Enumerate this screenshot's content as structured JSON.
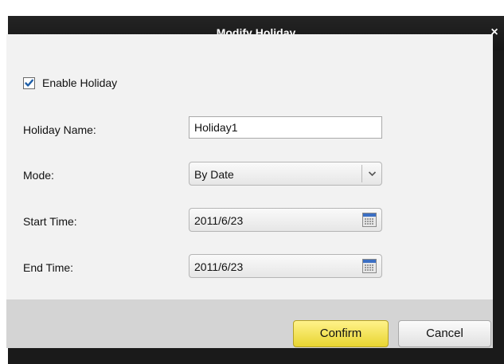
{
  "dialog": {
    "title": "Modify Holiday",
    "close_icon": "close-icon",
    "close_glyph": "×"
  },
  "form": {
    "enable": {
      "label": "Enable Holiday",
      "checked": true
    },
    "holiday_name": {
      "label": "Holiday Name:",
      "value": "Holiday1"
    },
    "mode": {
      "label": "Mode:",
      "value": "By Date",
      "icon": "chevron-down-icon"
    },
    "start_time": {
      "label": "Start Time:",
      "value": "2011/6/23",
      "icon": "calendar-icon"
    },
    "end_time": {
      "label": "End Time:",
      "value": "2011/6/23",
      "icon": "calendar-icon"
    }
  },
  "footer": {
    "confirm_label": "Confirm",
    "cancel_label": "Cancel"
  },
  "colors": {
    "titlebar": "#1a1a1a",
    "body_bg": "#f2f2f2",
    "footer_bg": "#d4d4d4",
    "confirm_bg": "#f0e04f",
    "checkmark": "#1f5fa8"
  }
}
